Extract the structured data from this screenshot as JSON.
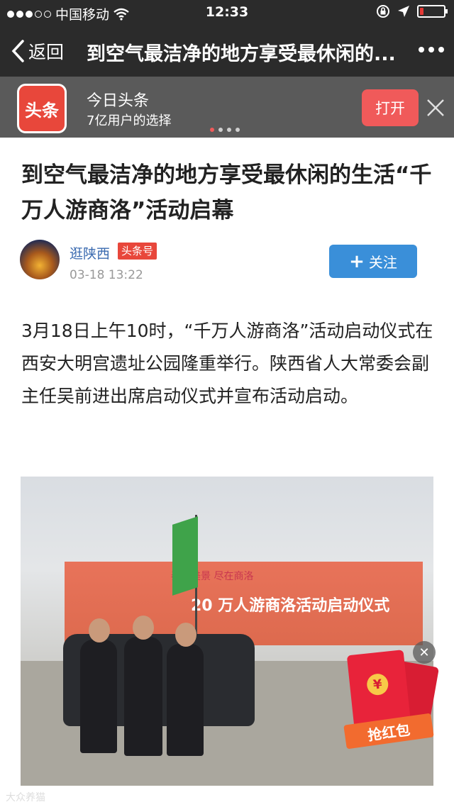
{
  "status": {
    "carrier": "中国移动",
    "time": "12:33"
  },
  "nav": {
    "back_label": "返回",
    "title": "到空气最洁净的地方享受最休闲的..."
  },
  "banner": {
    "logo_text": "头条",
    "app_name": "今日头条",
    "slogan": "7亿用户的选择",
    "open_label": "打开"
  },
  "article": {
    "title": "到空气最洁净的地方享受最休闲的生活“千万人游商洛”活动启幕",
    "author": "逛陕西",
    "author_tag": "头条号",
    "time": "03-18 13:22",
    "follow_label": "关注",
    "body": "3月18日上午10时，“千万人游商洛”活动启动仪式在西安大明宫遗址公园隆重举行。陕西省人大常委会副主任吴前进出席启动仪式并宣布活动启动。"
  },
  "photo": {
    "billboard_line1": "秦岭美景 尽在商洛",
    "billboard_line2": "20 万人游商洛活动启动仪式"
  },
  "red_packet": {
    "label": "抢红包",
    "symbol": "¥"
  },
  "watermark": "大众养猫",
  "colors": {
    "bar_bg": "#2b2b2b",
    "banner_bg": "#5a5a5a",
    "brand_red": "#e8473b",
    "follow_blue": "#3a8fd9",
    "author_blue": "#3b6bb0"
  },
  "icons": {
    "wifi": "wifi-icon",
    "location": "location-arrow-icon",
    "lock": "rotation-lock-icon",
    "battery": "battery-icon",
    "back": "chevron-left-icon",
    "more": "more-dots-icon",
    "close": "close-icon"
  },
  "battery_level": 0.15
}
